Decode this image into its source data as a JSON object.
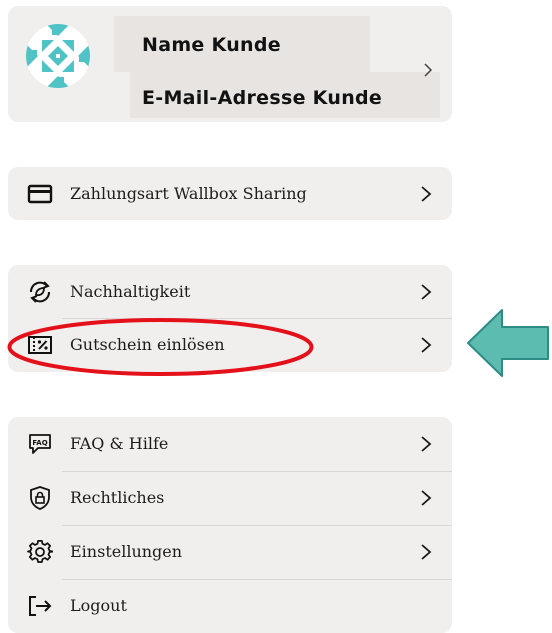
{
  "profile": {
    "name": "Name Kunde",
    "email": "E-Mail-Adresse Kunde",
    "avatar_icon": "geometric-pattern-avatar",
    "avatar_color": "#4fc3c6"
  },
  "payment": {
    "label": "Zahlungsart Wallbox Sharing",
    "icon": "credit-card-icon"
  },
  "section_two": [
    {
      "label": "Nachhaltigkeit",
      "icon": "leaf-cycle-icon"
    },
    {
      "label": "Gutschein einlösen",
      "icon": "voucher-percent-icon"
    }
  ],
  "section_three": [
    {
      "label": "FAQ & Hilfe",
      "icon": "faq-bubble-icon"
    },
    {
      "label": "Rechtliches",
      "icon": "shield-lock-icon"
    },
    {
      "label": "Einstellungen",
      "icon": "gear-icon"
    },
    {
      "label": "Logout",
      "icon": "logout-icon"
    }
  ],
  "annotation": {
    "highlight_color": "#e4111b",
    "arrow_fill": "#5cbcb0",
    "arrow_stroke": "#2e8c84"
  }
}
